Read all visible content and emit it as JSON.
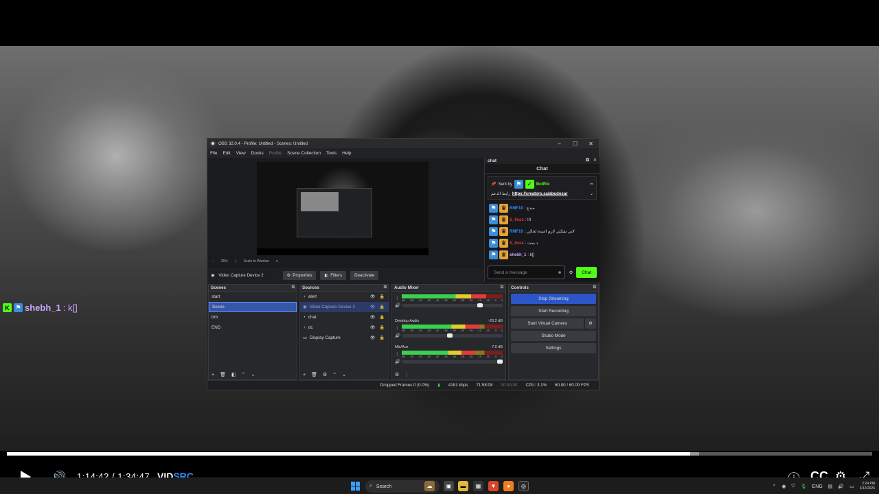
{
  "overlay_chat": {
    "username": "shebh_1",
    "message": ": k[]"
  },
  "player": {
    "progress": 0.79,
    "buffered": 0.8,
    "current_time": "1:14:42",
    "separator": "/",
    "duration": "1:34:47",
    "brand_a": "VID",
    "brand_b": "SRC"
  },
  "taskbar": {
    "search_placeholder": "Search",
    "lang": "ENG",
    "time": "2:24 PM",
    "date": "3/12/2026"
  },
  "obs": {
    "title": "OBS 32.0.4 - Profile: Untitled - Scenes: Untitled",
    "menu": [
      "File",
      "Edit",
      "View",
      "Docks",
      "Profile",
      "Scene Collection",
      "Tools",
      "Help"
    ],
    "preview_zoom": "25%",
    "scale_mode": "Scale to Window",
    "source_toolbar": {
      "current_source": "Video Capture Device 2",
      "properties": "Properties",
      "filters": "Filters",
      "deactivate": "Deactivate"
    },
    "scenes": {
      "title": "Scenes",
      "items": [
        "start",
        "Scene",
        "brb",
        "END"
      ],
      "selected": 1
    },
    "sources": {
      "title": "Sources",
      "items": [
        "alert",
        "Video Capture Device 2",
        "chat",
        "dc",
        "Display Capture"
      ]
    },
    "mixer": {
      "title": "Audio Mixer",
      "channels": [
        {
          "name": "",
          "db": "",
          "level": 0.84,
          "fader": 0.8
        },
        {
          "name": "Desktop Audio",
          "db": "-20.2 dB",
          "level": 0.77,
          "fader": 0.5
        },
        {
          "name": "Mic/Aux",
          "db": "7.0 dB",
          "level": 0.72,
          "fader": 1.0
        }
      ],
      "ticks": [
        "-60",
        "-55",
        "-50",
        "-45",
        "-40",
        "-35",
        "-30",
        "-25",
        "-20",
        "-15",
        "-10",
        "-5",
        "0"
      ]
    },
    "controls": {
      "title": "Controls",
      "stop_streaming": "Stop Streaming",
      "start_recording": "Start Recording",
      "start_virtual_camera": "Start Virtual Camera",
      "studio_mode": "Studio Mode",
      "settings": "Settings"
    },
    "status": {
      "dropped_frames": "Dropped Frames 0 (0.0%)",
      "bitrate": "4181 kbps",
      "stream_time": "71:58:08",
      "rec_time": "00:00:00",
      "cpu": "CPU: 3.1%",
      "fps": "60.00 / 60.00 FPS"
    },
    "chat": {
      "dock_title": "chat",
      "header": "Chat",
      "pinned_by_label": "Sent by",
      "pinned_by": "BotRix",
      "pinned_text": "رابط الدعم",
      "pinned_link": "https://creators.sa/abudosar",
      "messages": [
        {
          "user": "RMF10",
          "text": ": مبدع",
          "color": "#2f8fff"
        },
        {
          "user": "S_0sss",
          "text": ": ااا",
          "color": "#e33b3b"
        },
        {
          "user": "RMF10",
          "text": ": لاني شكلي لازم اعيده لحالي",
          "color": "#2f8fff"
        },
        {
          "user": "S_0sss",
          "text": ": د بمت",
          "color": "#e33b3b"
        },
        {
          "user": "shebh_1",
          "text": ": k[]",
          "color": "#c9a6ff"
        }
      ],
      "input_placeholder": "Send a message",
      "send": "Chat"
    }
  }
}
